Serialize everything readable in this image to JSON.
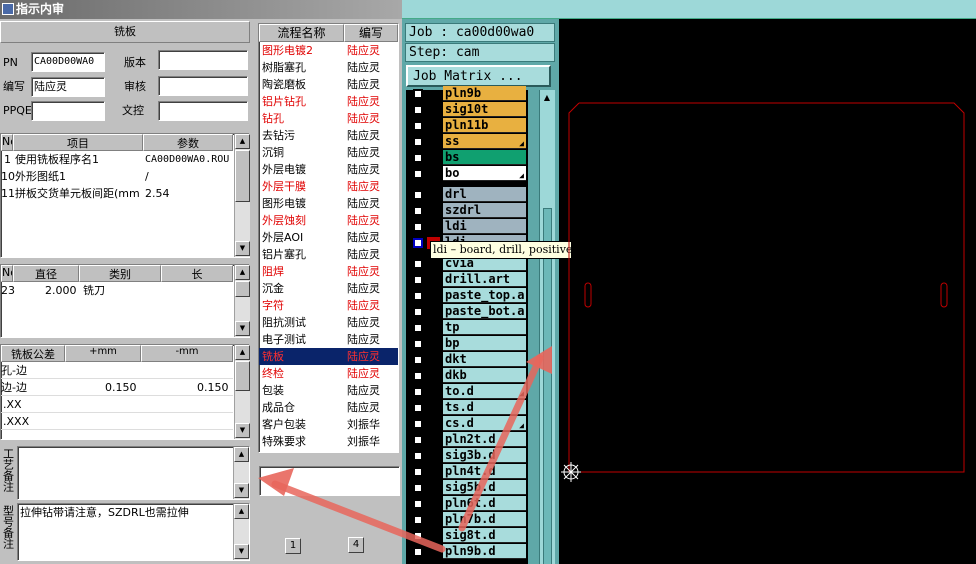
{
  "window": {
    "title": "指示内审"
  },
  "board": {
    "header": "铣板",
    "pn_label": "PN",
    "pn_value": "CA00D00WA0",
    "version_label": "版本",
    "version_value": "",
    "writer_label": "编写",
    "writer_value": "陆应灵",
    "review_label": "审核",
    "review_value": "",
    "ppqe_label": "PPQE",
    "ppqe_value": "",
    "wenkong_label": "文控",
    "wenkong_value": ""
  },
  "items_table": {
    "headers": [
      "No",
      "项目",
      "参数"
    ],
    "rows": [
      {
        "no": "1",
        "item": "使用铣板程序名1",
        "param": "CA00D00WA0.ROU"
      },
      {
        "no": "10",
        "item": "外形图纸1",
        "param": "/"
      },
      {
        "no": "11",
        "item": "拼板交货单元板间距(mm",
        "param": "2.54"
      }
    ]
  },
  "tool_table": {
    "headers": [
      "No",
      "直径",
      "类别",
      "长"
    ],
    "rows": [
      {
        "no": "23",
        "dia": "2.000",
        "type": "铣刀",
        "len": ""
      }
    ]
  },
  "tolerance_table": {
    "headers": [
      "铣板公差",
      "+mm",
      "-mm"
    ],
    "rows": [
      {
        "name": "孔-边",
        "plus": "",
        "minus": ""
      },
      {
        "name": "边-边",
        "plus": "0.150",
        "minus": "0.150"
      },
      {
        "name": ".XX",
        "plus": "",
        "minus": ""
      },
      {
        "name": ".XXX",
        "plus": "",
        "minus": ""
      }
    ]
  },
  "notes": {
    "craft_label": "工艺备注",
    "craft_value": "",
    "type_label": "型号备注",
    "type_value": "拉伸钻带请注意，SZDRL也需拉伸"
  },
  "process": {
    "headers": [
      "流程名称",
      "编写"
    ],
    "rows": [
      {
        "name": "图形电镀2",
        "writer": "陆应灵",
        "red": true
      },
      {
        "name": "树脂塞孔",
        "writer": "陆应灵",
        "red": false
      },
      {
        "name": "陶瓷磨板",
        "writer": "陆应灵",
        "red": false
      },
      {
        "name": "铝片钻孔",
        "writer": "陆应灵",
        "red": true
      },
      {
        "name": "钻孔",
        "writer": "陆应灵",
        "red": true
      },
      {
        "name": "去钻污",
        "writer": "陆应灵",
        "red": false
      },
      {
        "name": "沉铜",
        "writer": "陆应灵",
        "red": false
      },
      {
        "name": "外层电镀",
        "writer": "陆应灵",
        "red": false
      },
      {
        "name": "外层干膜",
        "writer": "陆应灵",
        "red": true
      },
      {
        "name": "图形电镀",
        "writer": "陆应灵",
        "red": false
      },
      {
        "name": "外层蚀刻",
        "writer": "陆应灵",
        "red": true
      },
      {
        "name": "外层AOI",
        "writer": "陆应灵",
        "red": false
      },
      {
        "name": "铝片塞孔",
        "writer": "陆应灵",
        "red": false
      },
      {
        "name": "阻焊",
        "writer": "陆应灵",
        "red": true
      },
      {
        "name": "沉金",
        "writer": "陆应灵",
        "red": false
      },
      {
        "name": "字符",
        "writer": "陆应灵",
        "red": true
      },
      {
        "name": "阻抗测试",
        "writer": "陆应灵",
        "red": false
      },
      {
        "name": "电子测试",
        "writer": "陆应灵",
        "red": false
      },
      {
        "name": "铣板",
        "writer": "陆应灵",
        "red": true,
        "selected": true
      },
      {
        "name": "终检",
        "writer": "陆应灵",
        "red": true
      },
      {
        "name": "包装",
        "writer": "陆应灵",
        "red": false
      },
      {
        "name": "成品仓",
        "writer": "陆应灵",
        "red": false
      },
      {
        "name": "客户包装",
        "writer": "刘振华",
        "red": false
      },
      {
        "name": "特殊要求",
        "writer": "刘振华",
        "red": false
      }
    ],
    "page_left": "1",
    "page_right": "4"
  },
  "job": {
    "job_label": "Job : ca00d00wa0",
    "step_label": "Step: cam",
    "matrix_button": "Job Matrix ..."
  },
  "layers": [
    {
      "name": "pln9b",
      "color": "#e8b040",
      "mark": ""
    },
    {
      "name": "sig10t",
      "color": "#e8b040",
      "mark": ""
    },
    {
      "name": "pln11b",
      "color": "#e8b040",
      "mark": ""
    },
    {
      "name": "ss",
      "color": "#e8b040",
      "mark": "◢"
    },
    {
      "name": "bs",
      "color": "#10a070",
      "mark": ""
    },
    {
      "name": "bo",
      "color": "#ffffff",
      "mark": "◢"
    },
    {
      "name": "drl",
      "color": "#9fb3bf",
      "mark": ""
    },
    {
      "name": "szdrl",
      "color": "#9fb3bf",
      "mark": ""
    },
    {
      "name": "ldi",
      "color": "#9fb3bf",
      "mark": ""
    },
    {
      "name": "ldi",
      "color": "#9fb3bf",
      "mark": ""
    },
    {
      "name": "cvia",
      "color": "#a8dcdc",
      "mark": ""
    },
    {
      "name": "drill.art",
      "color": "#a8dcdc",
      "mark": ""
    },
    {
      "name": "paste_top.art",
      "color": "#a8dcdc",
      "mark": ""
    },
    {
      "name": "paste_bot.art",
      "color": "#a8dcdc",
      "mark": ""
    },
    {
      "name": "tp",
      "color": "#a8dcdc",
      "mark": ""
    },
    {
      "name": "bp",
      "color": "#a8dcdc",
      "mark": ""
    },
    {
      "name": "dkt",
      "color": "#a8dcdc",
      "mark": ""
    },
    {
      "name": "dkb",
      "color": "#a8dcdc",
      "mark": ""
    },
    {
      "name": "to.d",
      "color": "#a8dcdc",
      "mark": "◢"
    },
    {
      "name": "ts.d",
      "color": "#a8dcdc",
      "mark": ""
    },
    {
      "name": "cs.d",
      "color": "#a8dcdc",
      "mark": "◢"
    },
    {
      "name": "pln2t.d",
      "color": "#a8dcdc",
      "mark": ""
    },
    {
      "name": "sig3b.d",
      "color": "#a8dcdc",
      "mark": ""
    },
    {
      "name": "pln4t.d",
      "color": "#a8dcdc",
      "mark": ""
    },
    {
      "name": "sig5b.d",
      "color": "#a8dcdc",
      "mark": ""
    },
    {
      "name": "pln6t.d",
      "color": "#a8dcdc",
      "mark": ""
    },
    {
      "name": "pln7b.d",
      "color": "#a8dcdc",
      "mark": ""
    },
    {
      "name": "sig8t.d",
      "color": "#a8dcdc",
      "mark": ""
    },
    {
      "name": "pln9b.d",
      "color": "#a8dcdc",
      "mark": ""
    }
  ],
  "tooltip": "ldi – board, drill, positive"
}
